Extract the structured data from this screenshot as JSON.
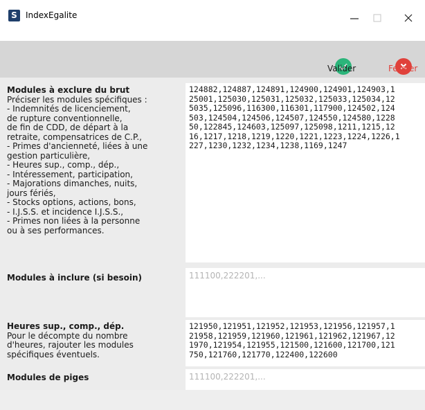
{
  "window": {
    "icon_letter": "S",
    "title": "IndexEgalite"
  },
  "toolbar": {
    "valider_label": "Valider",
    "fermer_label": "Fermer",
    "valider_color": "#2bb57a",
    "fermer_color": "#e0413b"
  },
  "fields": {
    "exclure": {
      "title": "Modules à exclure du brut",
      "description": [
        "Préciser les modules spécifiques :",
        "- Indemnités de licenciement,",
        "de rupture conventionnelle,",
        "de fin de CDD, de départ à la",
        "retraite, compensatrices de C.P.,",
        "- Primes d'ancienneté, liées à une",
        "gestion particulière,",
        "- Heures sup., comp., dép.,",
        "- Intéressement, participation,",
        "- Majorations dimanches, nuits,",
        "jours fériés,",
        "- Stocks options, actions, bons,",
        "- I.J.S.S. et incidence I.J.S.S.,",
        "- Primes non liées à la personne",
        "ou à ses performances."
      ],
      "value_lines": [
        "124882,124887,124891,124900,124901,124903,1",
        "25001,125030,125031,125032,125033,125034,12",
        "5035,125096,116300,116301,117900,124502,124",
        "503,124504,124506,124507,124550,124580,1228",
        "50,122845,124603,125097,125098,1211,1215,12",
        "16,1217,1218,1219,1220,1221,1223,1224,1226,1",
        "227,1230,1232,1234,1238,1169,1247"
      ]
    },
    "inclure": {
      "title": "Modules à inclure (si besoin)",
      "placeholder": "111100,222201,..."
    },
    "heures": {
      "title": "Heures sup., comp., dép.",
      "description": [
        "Pour le décompte du nombre",
        "d'heures, rajouter les modules",
        "spécifiques éventuels."
      ],
      "value_lines": [
        "121950,121951,121952,121953,121956,121957,1",
        "21958,121959,121960,121961,121962,121967,12",
        "1970,121954,121955,121500,121600,121700,121",
        "750,121760,121770,122400,122600"
      ]
    },
    "piges": {
      "title": "Modules de piges",
      "placeholder": "111100,222201,..."
    }
  }
}
